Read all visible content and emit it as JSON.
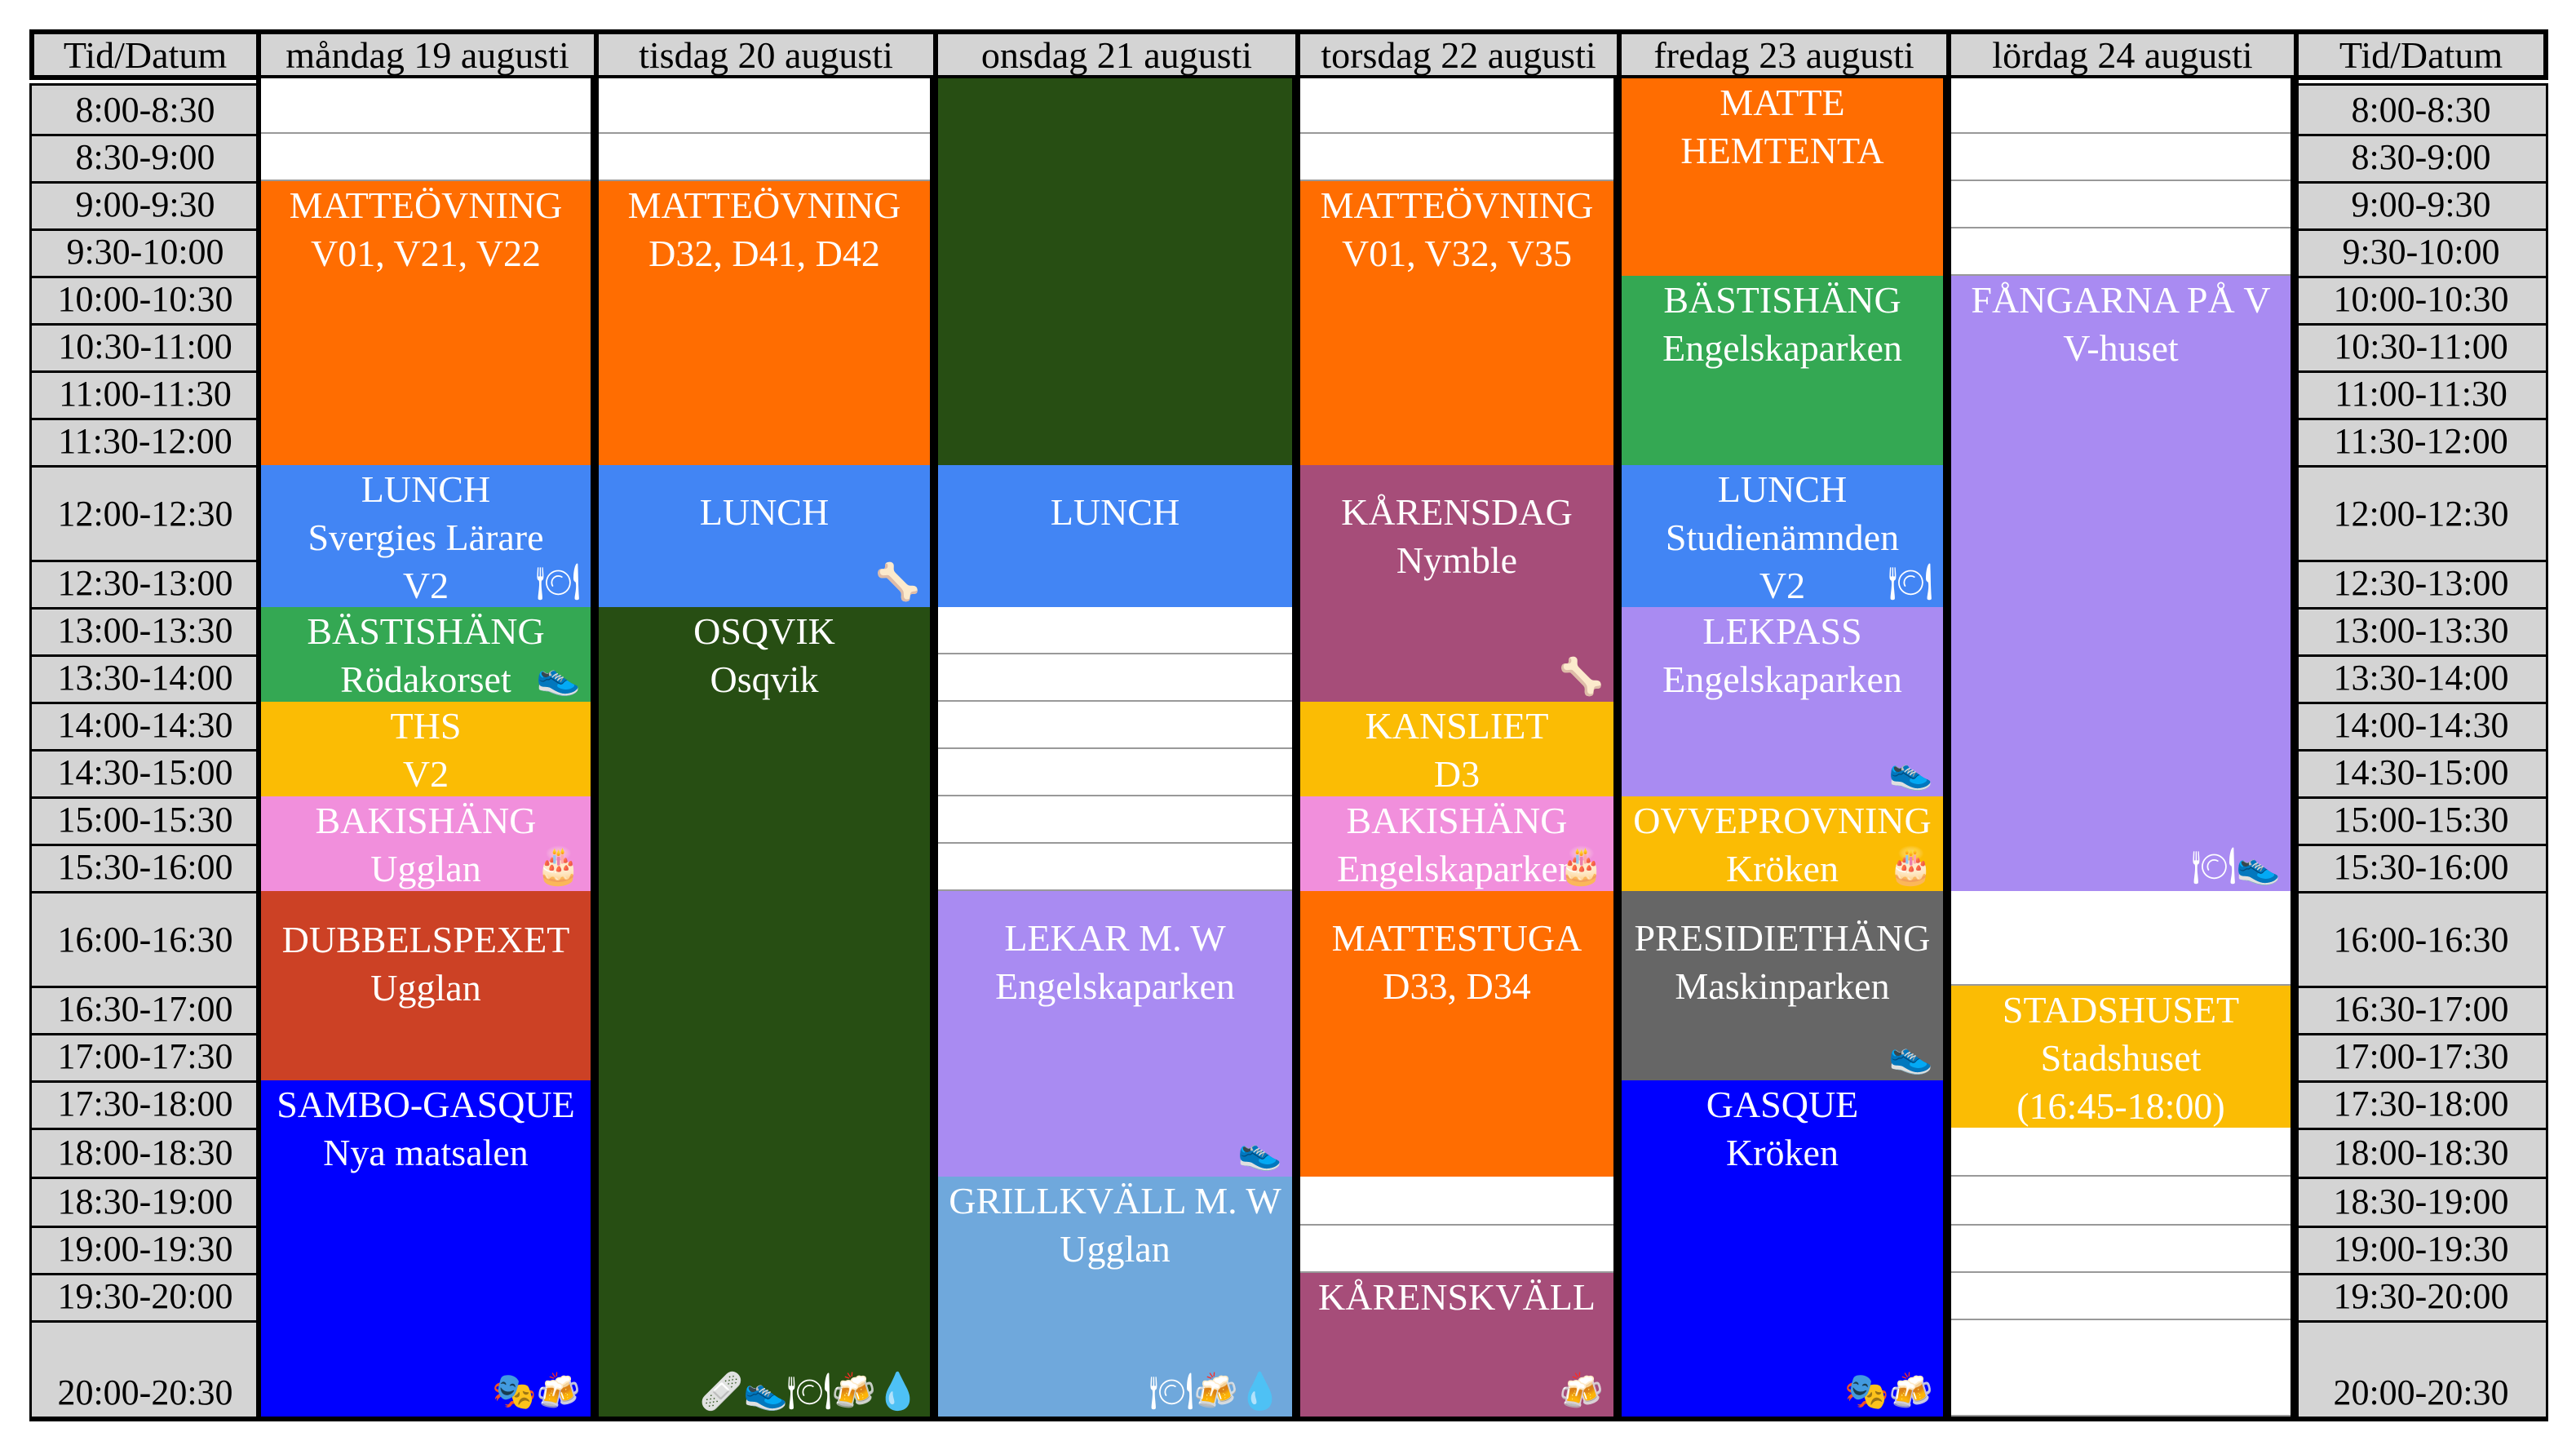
{
  "header": {
    "time_label_left": "Tid/Datum",
    "time_label_right": "Tid/Datum",
    "days": [
      "måndag 19 augusti",
      "tisdag 20 augusti",
      "onsdag 21 augusti",
      "torsdag 22 augusti",
      "fredag 23 augusti",
      "lördag 24 augusti"
    ]
  },
  "times": [
    "8:00-8:30",
    "8:30-9:00",
    "9:00-9:30",
    "9:30-10:00",
    "10:00-10:30",
    "10:30-11:00",
    "11:00-11:30",
    "11:30-12:00",
    "12:00-12:30",
    "12:30-13:00",
    "13:00-13:30",
    "13:30-14:00",
    "14:00-14:30",
    "14:30-15:00",
    "15:00-15:30",
    "15:30-16:00",
    "16:00-16:30",
    "16:30-17:00",
    "17:00-17:30",
    "17:30-18:00",
    "18:00-18:30",
    "18:30-19:00",
    "19:00-19:30",
    "19:30-20:00",
    "20:00-20:30"
  ],
  "colors": {
    "orange": "#ff6d01",
    "blue": "#4285f4",
    "green": "#34a853",
    "yellow": "#fbbc04",
    "pink": "#f18fdc",
    "red": "#cc4125",
    "darkgreen": "#274e13",
    "purple": "#a98bf2",
    "lightblue": "#6fa8dc",
    "plum": "#a64d79",
    "gray": "#666666",
    "royal": "#0000ff"
  },
  "events": {
    "mon": [
      {
        "lines": [
          "MATTEÖVNING",
          "V01, V21, V22"
        ],
        "color": "#ff6d01",
        "icons": []
      },
      {
        "lines": [
          "LUNCH",
          "Svergies Lärare",
          "V2"
        ],
        "color": "#4285f4",
        "icons": [
          "plate-icon"
        ]
      },
      {
        "lines": [
          "BÄSTISHÄNG",
          "Rödakorset"
        ],
        "color": "#34a853",
        "icons": [
          "shoe-icon"
        ]
      },
      {
        "lines": [
          "THS",
          "V2"
        ],
        "color": "#fbbc04",
        "icons": []
      },
      {
        "lines": [
          "BAKISHÄNG",
          "Ugglan"
        ],
        "color": "#f18fdc",
        "icons": [
          "cake-icon"
        ]
      },
      {
        "lines": [
          "DUBBELSPEXET",
          "Ugglan"
        ],
        "color": "#cc4125",
        "icons": []
      },
      {
        "lines": [
          "SAMBO-GASQUE",
          "Nya matsalen"
        ],
        "color": "#0000ff",
        "icons": [
          "mask-icon",
          "beer-icon"
        ]
      }
    ],
    "tue": [
      {
        "lines": [
          "MATTEÖVNING",
          "D32, D41, D42"
        ],
        "color": "#ff6d01",
        "icons": []
      },
      {
        "lines": [
          "LUNCH"
        ],
        "color": "#4285f4",
        "icons": [
          "bone-icon"
        ]
      },
      {
        "lines": [
          "OSQVIK",
          "Osqvik"
        ],
        "color": "#274e13",
        "icons": [
          "bandage-icon",
          "shoe-icon",
          "plate-icon",
          "beer-icon",
          "water-drop-icon"
        ]
      }
    ],
    "wed": [
      {
        "lines": [],
        "color": "#274e13",
        "icons": []
      },
      {
        "lines": [
          "LUNCH"
        ],
        "color": "#4285f4",
        "icons": []
      },
      {
        "lines": [
          "LEKAR M. W",
          "Engelskaparken"
        ],
        "color": "#a98bf2",
        "icons": [
          "shoe-icon"
        ]
      },
      {
        "lines": [
          "GRILLKVÄLL M. W",
          "Ugglan"
        ],
        "color": "#6fa8dc",
        "icons": [
          "plate-icon",
          "beer-icon",
          "water-drop-icon"
        ]
      }
    ],
    "thu": [
      {
        "lines": [
          "MATTEÖVNING",
          "V01, V32, V35"
        ],
        "color": "#ff6d01",
        "icons": []
      },
      {
        "lines": [
          "KÅRENSDAG",
          "Nymble"
        ],
        "color": "#a64d79",
        "icons": [
          "bone-icon"
        ]
      },
      {
        "lines": [
          "KANSLIET",
          "D3"
        ],
        "color": "#fbbc04",
        "icons": []
      },
      {
        "lines": [
          "BAKISHÄNG",
          "Engelskaparken"
        ],
        "color": "#f18fdc",
        "icons": [
          "cake-icon"
        ]
      },
      {
        "lines": [
          "MATTESTUGA",
          "D33, D34"
        ],
        "color": "#ff6d01",
        "icons": []
      },
      {
        "lines": [
          "KÅRENSKVÄLL"
        ],
        "color": "#a64d79",
        "icons": [
          "beer-icon"
        ]
      }
    ],
    "fri": [
      {
        "lines": [
          "MATTE",
          "HEMTENTA"
        ],
        "color": "#ff6d01",
        "icons": []
      },
      {
        "lines": [
          "BÄSTISHÄNG",
          "Engelskaparken"
        ],
        "color": "#34a853",
        "icons": []
      },
      {
        "lines": [
          "LUNCH",
          "Studienämnden",
          "V2"
        ],
        "color": "#4285f4",
        "icons": [
          "plate-icon"
        ]
      },
      {
        "lines": [
          "LEKPASS",
          "Engelskaparken"
        ],
        "color": "#a98bf2",
        "icons": [
          "shoe-icon"
        ]
      },
      {
        "lines": [
          "OVVEPROVNING",
          "Kröken"
        ],
        "color": "#fbbc04",
        "icons": [
          "cake-icon"
        ]
      },
      {
        "lines": [
          "PRESIDIETHÄNG",
          "Maskinparken"
        ],
        "color": "#666666",
        "icons": [
          "shoe-icon"
        ]
      },
      {
        "lines": [
          "GASQUE",
          "Kröken"
        ],
        "color": "#0000ff",
        "icons": [
          "mask-icon",
          "beer-icon"
        ]
      }
    ],
    "sat": [
      {
        "lines": [
          "FÅNGARNA PÅ V",
          "V-huset"
        ],
        "color": "#a98bf2",
        "icons": [
          "plate-icon",
          "shoe-icon"
        ]
      },
      {
        "lines": [
          "STADSHUSET",
          "Stadshuset",
          "(16:45-18:00)"
        ],
        "color": "#fbbc04",
        "icons": []
      }
    ]
  }
}
